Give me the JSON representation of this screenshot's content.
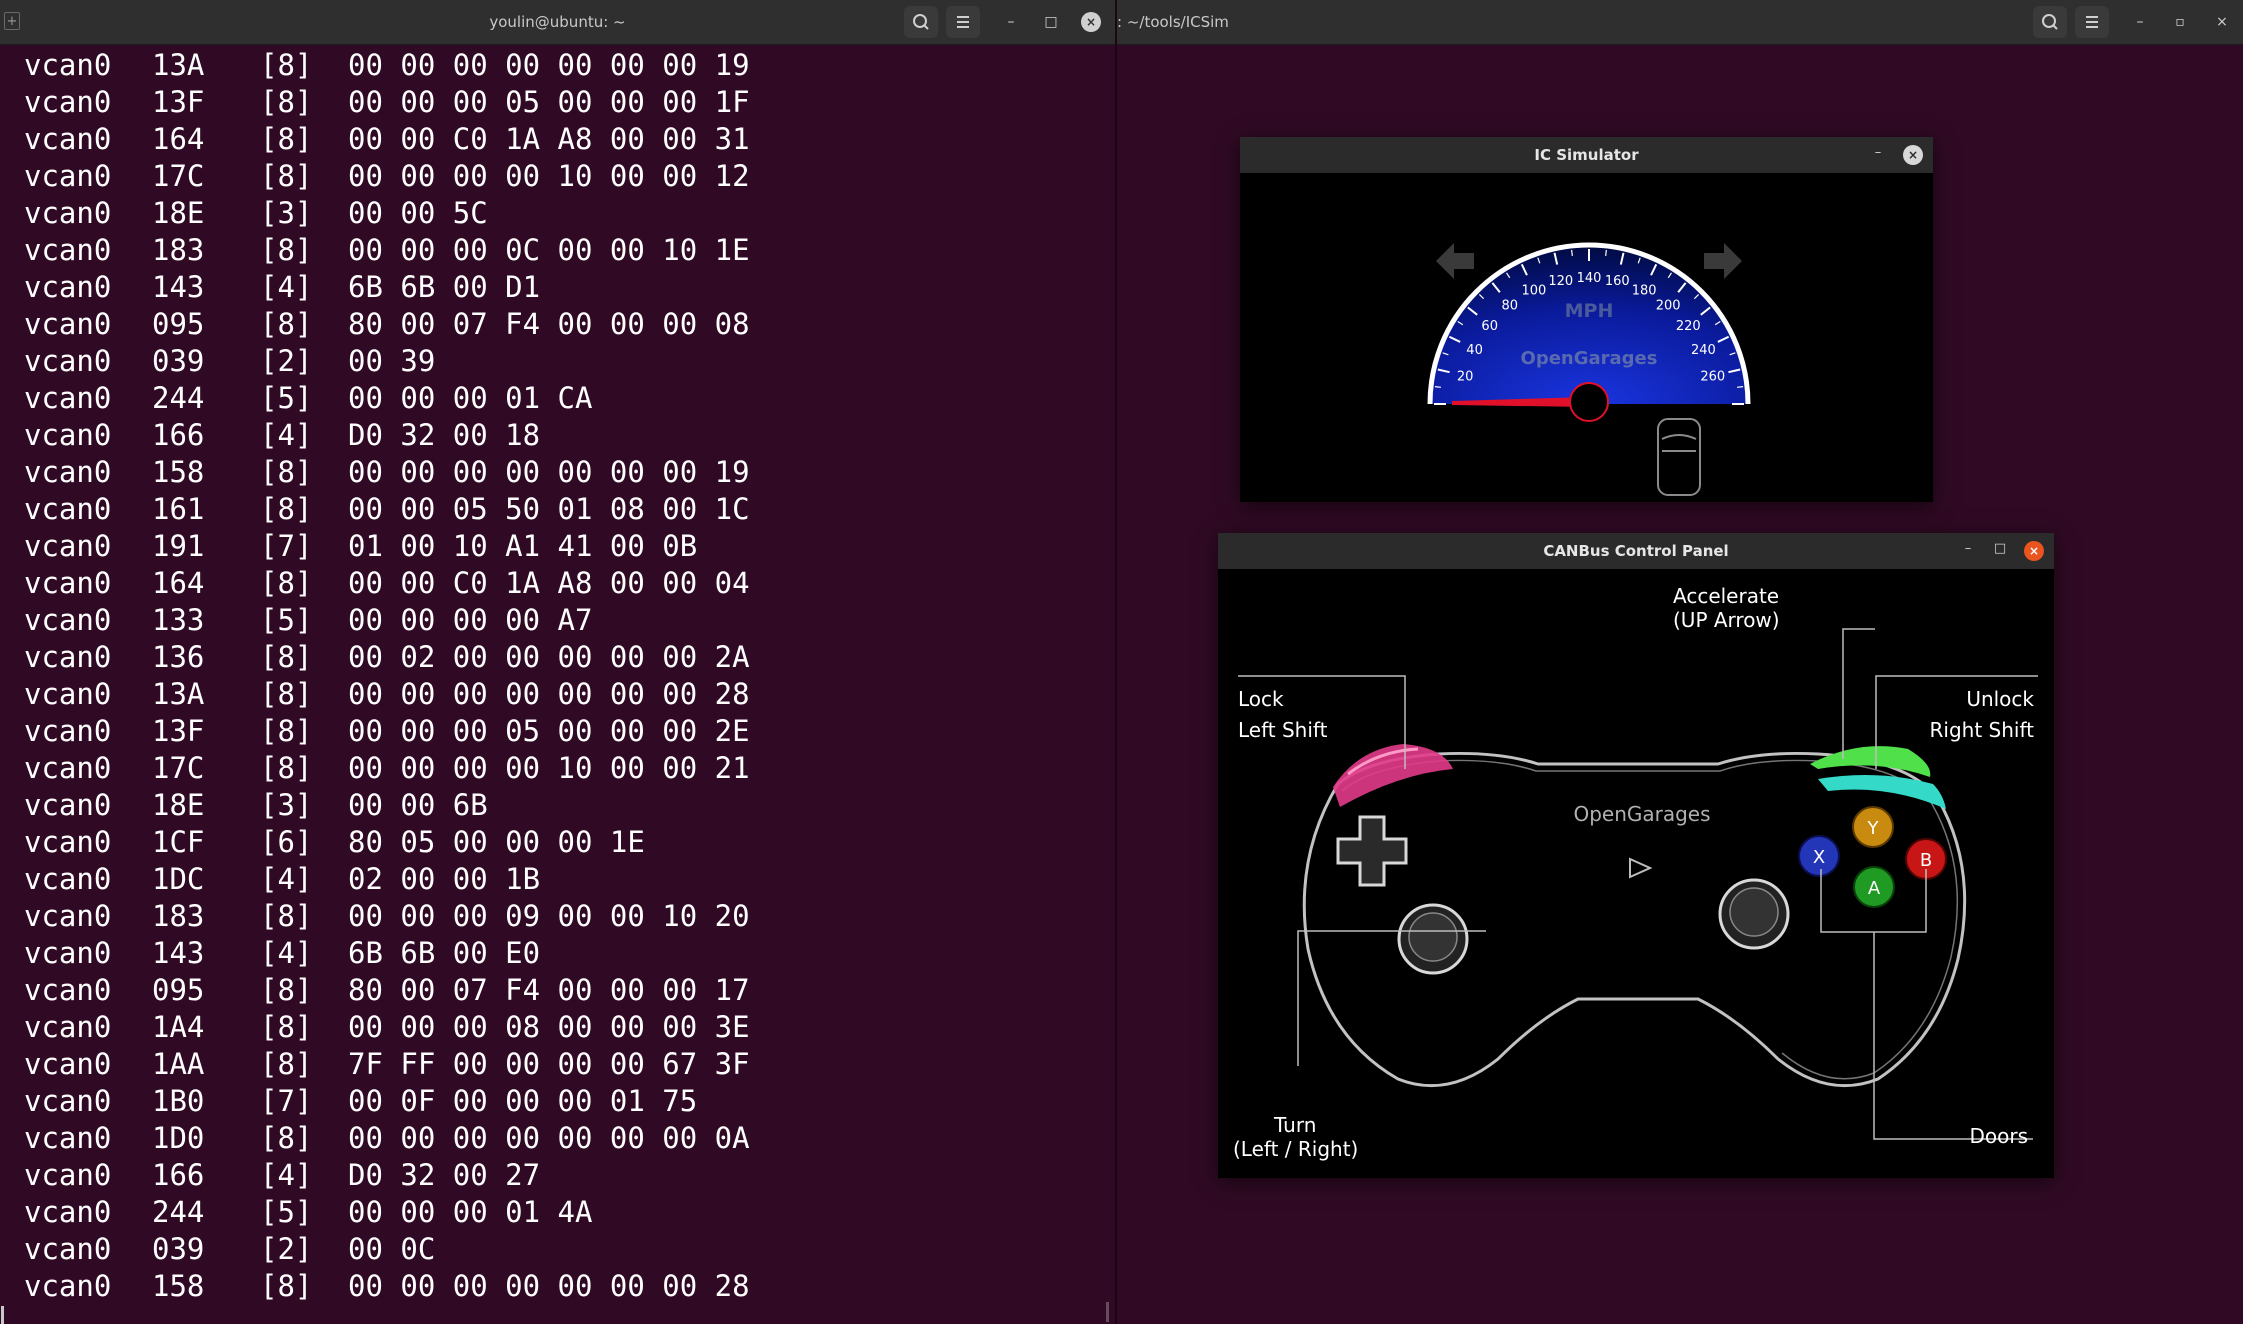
{
  "left_terminal": {
    "title": "youlin@ubuntu: ~",
    "search_icon": "search-icon",
    "menu_icon": "hamburger-menu-icon",
    "minimize": "–",
    "maximize": "□",
    "close": "×",
    "rows": [
      {
        "iface": "vcan0",
        "id": "13A",
        "len": "[8]",
        "data": "00 00 00 00 00 00 00 19"
      },
      {
        "iface": "vcan0",
        "id": "13F",
        "len": "[8]",
        "data": "00 00 00 05 00 00 00 1F"
      },
      {
        "iface": "vcan0",
        "id": "164",
        "len": "[8]",
        "data": "00 00 C0 1A A8 00 00 31"
      },
      {
        "iface": "vcan0",
        "id": "17C",
        "len": "[8]",
        "data": "00 00 00 00 10 00 00 12"
      },
      {
        "iface": "vcan0",
        "id": "18E",
        "len": "[3]",
        "data": "00 00 5C"
      },
      {
        "iface": "vcan0",
        "id": "183",
        "len": "[8]",
        "data": "00 00 00 0C 00 00 10 1E"
      },
      {
        "iface": "vcan0",
        "id": "143",
        "len": "[4]",
        "data": "6B 6B 00 D1"
      },
      {
        "iface": "vcan0",
        "id": "095",
        "len": "[8]",
        "data": "80 00 07 F4 00 00 00 08"
      },
      {
        "iface": "vcan0",
        "id": "039",
        "len": "[2]",
        "data": "00 39"
      },
      {
        "iface": "vcan0",
        "id": "244",
        "len": "[5]",
        "data": "00 00 00 01 CA"
      },
      {
        "iface": "vcan0",
        "id": "166",
        "len": "[4]",
        "data": "D0 32 00 18"
      },
      {
        "iface": "vcan0",
        "id": "158",
        "len": "[8]",
        "data": "00 00 00 00 00 00 00 19"
      },
      {
        "iface": "vcan0",
        "id": "161",
        "len": "[8]",
        "data": "00 00 05 50 01 08 00 1C"
      },
      {
        "iface": "vcan0",
        "id": "191",
        "len": "[7]",
        "data": "01 00 10 A1 41 00 0B"
      },
      {
        "iface": "vcan0",
        "id": "164",
        "len": "[8]",
        "data": "00 00 C0 1A A8 00 00 04"
      },
      {
        "iface": "vcan0",
        "id": "133",
        "len": "[5]",
        "data": "00 00 00 00 A7"
      },
      {
        "iface": "vcan0",
        "id": "136",
        "len": "[8]",
        "data": "00 02 00 00 00 00 00 2A"
      },
      {
        "iface": "vcan0",
        "id": "13A",
        "len": "[8]",
        "data": "00 00 00 00 00 00 00 28"
      },
      {
        "iface": "vcan0",
        "id": "13F",
        "len": "[8]",
        "data": "00 00 00 05 00 00 00 2E"
      },
      {
        "iface": "vcan0",
        "id": "17C",
        "len": "[8]",
        "data": "00 00 00 00 10 00 00 21"
      },
      {
        "iface": "vcan0",
        "id": "18E",
        "len": "[3]",
        "data": "00 00 6B"
      },
      {
        "iface": "vcan0",
        "id": "1CF",
        "len": "[6]",
        "data": "80 05 00 00 00 1E"
      },
      {
        "iface": "vcan0",
        "id": "1DC",
        "len": "[4]",
        "data": "02 00 00 1B"
      },
      {
        "iface": "vcan0",
        "id": "183",
        "len": "[8]",
        "data": "00 00 00 09 00 00 10 20"
      },
      {
        "iface": "vcan0",
        "id": "143",
        "len": "[4]",
        "data": "6B 6B 00 E0"
      },
      {
        "iface": "vcan0",
        "id": "095",
        "len": "[8]",
        "data": "80 00 07 F4 00 00 00 17"
      },
      {
        "iface": "vcan0",
        "id": "1A4",
        "len": "[8]",
        "data": "00 00 00 08 00 00 00 3E"
      },
      {
        "iface": "vcan0",
        "id": "1AA",
        "len": "[8]",
        "data": "7F FF 00 00 00 00 67 3F"
      },
      {
        "iface": "vcan0",
        "id": "1B0",
        "len": "[7]",
        "data": "00 0F 00 00 00 01 75"
      },
      {
        "iface": "vcan0",
        "id": "1D0",
        "len": "[8]",
        "data": "00 00 00 00 00 00 00 0A"
      },
      {
        "iface": "vcan0",
        "id": "166",
        "len": "[4]",
        "data": "D0 32 00 27"
      },
      {
        "iface": "vcan0",
        "id": "244",
        "len": "[5]",
        "data": "00 00 00 01 4A"
      },
      {
        "iface": "vcan0",
        "id": "039",
        "len": "[2]",
        "data": "00 0C"
      },
      {
        "iface": "vcan0",
        "id": "158",
        "len": "[8]",
        "data": "00 00 00 00 00 00 00 28"
      }
    ]
  },
  "right_terminal": {
    "title": ": ~/tools/ICSim",
    "restore": "▫"
  },
  "ic_simulator": {
    "title": "IC Simulator",
    "unit": "MPH",
    "brand": "OpenGarages",
    "ticks": [
      "20",
      "40",
      "60",
      "80",
      "100",
      "120",
      "140",
      "160",
      "180",
      "200",
      "220",
      "240",
      "260"
    ],
    "speed": 0,
    "left_signal": "left-turn-arrow-icon",
    "right_signal": "right-turn-arrow-icon",
    "car_icon": "car-top-view-icon",
    "colors": {
      "dial_center": "#1a35e0",
      "dial_edge": "#000a40",
      "needle": "#e0102a",
      "signal": "#3a3a3a"
    }
  },
  "control_panel": {
    "title": "CANBus Control Panel",
    "brand": "OpenGarages",
    "accelerate": "Accelerate",
    "accelerate_key": "(UP Arrow)",
    "lock": "Lock",
    "lock_key": "Left Shift",
    "unlock": "Unlock",
    "unlock_key": "Right Shift",
    "turn": "Turn",
    "turn_key": "(Left / Right)",
    "doors": "Doors",
    "buttons": {
      "y": "Y",
      "x": "X",
      "b": "B",
      "a": "A"
    },
    "colors": {
      "lock_bumper": "#e23a8a",
      "unlock_bumper": "#4fe04a",
      "unlock_bumper2": "#35d9c8",
      "y": "#c98a10",
      "x": "#2436b8",
      "b": "#c81616",
      "a": "#1f9a22",
      "close": "#e9541f"
    }
  }
}
